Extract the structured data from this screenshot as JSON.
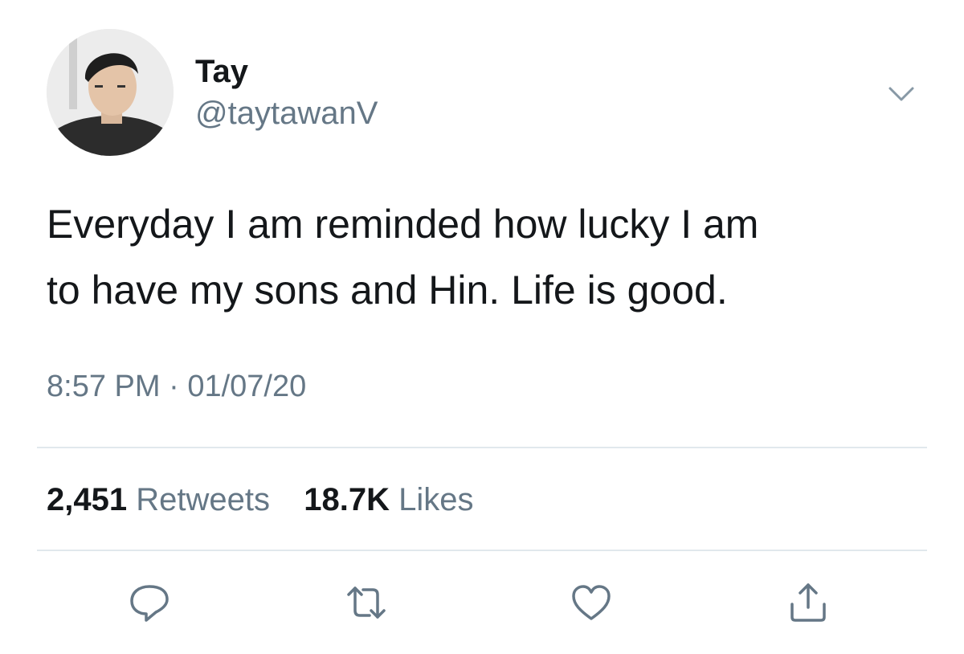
{
  "user": {
    "display_name": "Tay",
    "handle": "@taytawanV"
  },
  "tweet": {
    "text_line1": "Everyday I am reminded how lucky I am",
    "text_line2": "to have my sons and Hin. Life is good.",
    "time": "8:57 PM",
    "separator": "·",
    "date": "01/07/20"
  },
  "stats": {
    "retweets_count": "2,451",
    "retweets_label": "Retweets",
    "likes_count": "18.7K",
    "likes_label": "Likes"
  },
  "icons": {
    "more": "chevron-down-icon",
    "reply": "reply-icon",
    "retweet": "retweet-icon",
    "like": "heart-icon",
    "share": "share-icon"
  },
  "colors": {
    "text": "#14171a",
    "secondary": "#657786",
    "divider": "#e1e8ed"
  }
}
